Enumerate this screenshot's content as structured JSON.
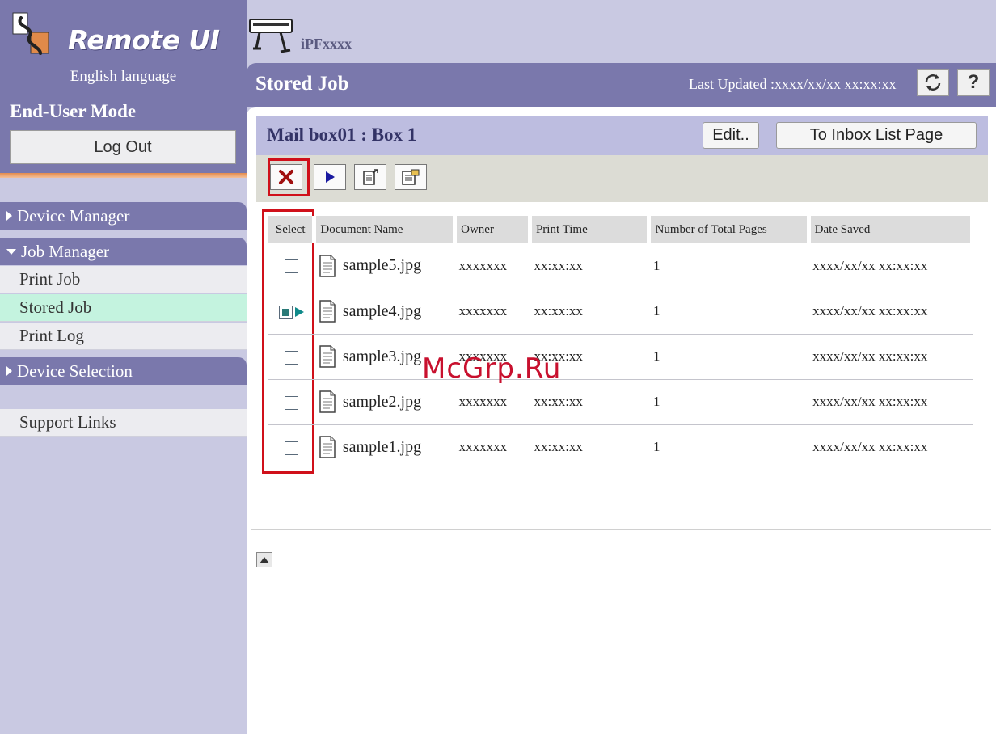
{
  "app": {
    "logo_text": "Remote UI",
    "language": "English language",
    "mode": "End-User Mode",
    "logout_label": "Log Out"
  },
  "nav": {
    "device_manager": "Device Manager",
    "job_manager": "Job Manager",
    "print_job": "Print Job",
    "stored_job": "Stored Job",
    "print_log": "Print Log",
    "device_selection": "Device Selection",
    "support_links": "Support Links"
  },
  "printer": {
    "name": "iPFxxxx"
  },
  "header": {
    "title": "Stored Job",
    "last_updated": "Last Updated :xxxx/xx/xx xx:xx:xx",
    "help_label": "?"
  },
  "box": {
    "title": "Mail box01 : Box 1",
    "edit_label": "Edit..",
    "inbox_label": "To Inbox List Page"
  },
  "table": {
    "headers": {
      "select": "Select",
      "document_name": "Document Name",
      "owner": "Owner",
      "print_time": "Print Time",
      "total_pages": "Number of Total Pages",
      "date_saved": "Date Saved"
    },
    "rows": [
      {
        "selected": false,
        "name": "sample5.jpg",
        "owner": "xxxxxxx",
        "print_time": "xx:xx:xx",
        "pages": "1",
        "date_saved": "xxxx/xx/xx xx:xx:xx"
      },
      {
        "selected": true,
        "name": "sample4.jpg",
        "owner": "xxxxxxx",
        "print_time": "xx:xx:xx",
        "pages": "1",
        "date_saved": "xxxx/xx/xx xx:xx:xx"
      },
      {
        "selected": false,
        "name": "sample3.jpg",
        "owner": "xxxxxxx",
        "print_time": "xx:xx:xx",
        "pages": "1",
        "date_saved": "xxxx/xx/xx xx:xx:xx"
      },
      {
        "selected": false,
        "name": "sample2.jpg",
        "owner": "xxxxxxx",
        "print_time": "xx:xx:xx",
        "pages": "1",
        "date_saved": "xxxx/xx/xx xx:xx:xx"
      },
      {
        "selected": false,
        "name": "sample1.jpg",
        "owner": "xxxxxxx",
        "print_time": "xx:xx:xx",
        "pages": "1",
        "date_saved": "xxxx/xx/xx xx:xx:xx"
      }
    ]
  },
  "watermark": "McGrp.Ru",
  "icons": [
    "remote-ui-logo-icon",
    "printer-icon",
    "refresh-icon",
    "delete-icon",
    "print-icon",
    "move-icon",
    "properties-icon",
    "document-icon",
    "scroll-top-icon"
  ],
  "colors": {
    "nav_purple": "#7a78ac",
    "light_purple": "#c9c9e2",
    "active_item": "#c4f3df",
    "highlight_red": "#d0101a"
  }
}
